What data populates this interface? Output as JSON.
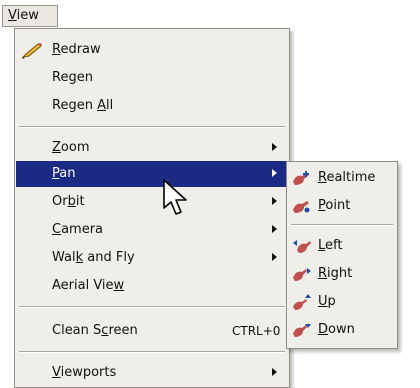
{
  "menubar": {
    "view": {
      "pre": "",
      "mn": "V",
      "post": "iew"
    }
  },
  "menu": {
    "redraw": {
      "pre": "",
      "mn": "R",
      "post": "edraw",
      "icon": "pencil-icon"
    },
    "regen": {
      "pre": "Re",
      "mn": "g",
      "post": "en"
    },
    "regen_all": {
      "pre": "Regen ",
      "mn": "A",
      "post": "ll"
    },
    "zoom": {
      "pre": "",
      "mn": "Z",
      "post": "oom"
    },
    "pan": {
      "pre": "",
      "mn": "P",
      "post": "an"
    },
    "orbit": {
      "pre": "Or",
      "mn": "b",
      "post": "it"
    },
    "camera": {
      "pre": "",
      "mn": "C",
      "post": "amera"
    },
    "walk_fly": {
      "pre": "Wal",
      "mn": "k",
      "post": " and Fly"
    },
    "aerial_view": {
      "pre": "Aerial Vie",
      "mn": "w",
      "post": ""
    },
    "clean_screen": {
      "pre": "Clean S",
      "mn": "c",
      "post": "reen",
      "shortcut": "CTRL+0"
    },
    "viewports": {
      "pre": "",
      "mn": "V",
      "post": "iewports"
    }
  },
  "pan_submenu": {
    "realtime": {
      "pre": "",
      "mn": "R",
      "post": "ealtime",
      "icon": "pan-realtime-icon"
    },
    "point": {
      "pre": "",
      "mn": "P",
      "post": "oint",
      "icon": "pan-point-icon"
    },
    "left": {
      "pre": "",
      "mn": "L",
      "post": "eft",
      "icon": "pan-left-icon"
    },
    "right": {
      "pre": "",
      "mn": "R",
      "post": "ight",
      "icon": "pan-right-icon"
    },
    "up": {
      "pre": "",
      "mn": "U",
      "post": "p",
      "icon": "pan-up-icon"
    },
    "down": {
      "pre": "",
      "mn": "D",
      "post": "own",
      "icon": "pan-down-icon"
    }
  },
  "colors": {
    "highlight": "#1b2b84",
    "menu_bg": "#f0eee8",
    "icon_red": "#c0504d",
    "icon_blue": "#1f4fa8"
  }
}
